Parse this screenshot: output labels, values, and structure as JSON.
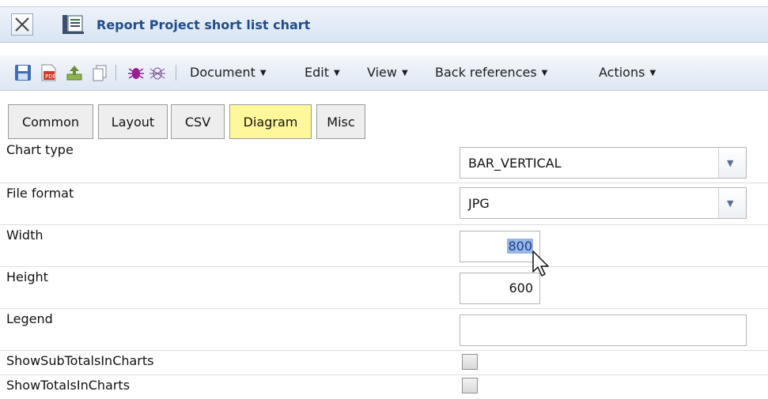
{
  "window": {
    "title": "Report Project short list chart",
    "close_icon": "close-icon",
    "report_icon": "report-icon"
  },
  "toolbar": {
    "icons": [
      "save-icon",
      "export-pdf-icon",
      "upload-icon",
      "copy-icon",
      "bug-icon",
      "bug-outline-icon"
    ],
    "menus": {
      "document": "Document",
      "edit": "Edit",
      "view": "View",
      "back_references": "Back references",
      "actions": "Actions"
    }
  },
  "tabs": {
    "common": "Common",
    "layout": "Layout",
    "csv": "CSV",
    "diagram": "Diagram",
    "misc": "Misc",
    "active": "Diagram"
  },
  "form": {
    "chart_type": {
      "label": "Chart type",
      "value": "BAR_VERTICAL"
    },
    "file_format": {
      "label": "File format",
      "value": "JPG"
    },
    "width": {
      "label": "Width",
      "value": "800"
    },
    "height": {
      "label": "Height",
      "value": "600"
    },
    "legend": {
      "label": "Legend",
      "value": ""
    },
    "show_sub_totals": {
      "label": "ShowSubTotalsInCharts",
      "checked": false
    },
    "show_totals": {
      "label": "ShowTotalsInCharts",
      "checked": false
    }
  },
  "colors": {
    "active_tab": "#fff79a",
    "title_text": "#1f4d8c",
    "selection": "#9ab6e6"
  }
}
